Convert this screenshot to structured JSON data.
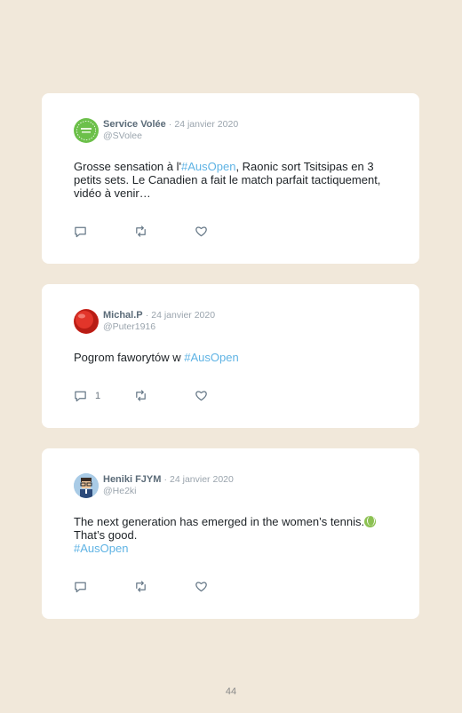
{
  "tweets": [
    {
      "name": "Service Volée",
      "separator": "·",
      "date": "24 janvier 2020",
      "handle": "@SVolee",
      "text_before": "Grosse sensation à l'",
      "hashtag": "#AusOpen",
      "text_after": ", Raonic sort Tsitsipas en 3 petits sets. Le Canadien a fait le match parfait tactiquement, vidéo à venir…",
      "reply_count": "",
      "avatar_color": "#6cc04a"
    },
    {
      "name": "Michal.P",
      "separator": "·",
      "date": "24 janvier 2020",
      "handle": "@Puter1916",
      "text_before": "Pogrom faworytów w ",
      "hashtag": "#AusOpen",
      "text_after": "",
      "reply_count": "1",
      "avatar_color": "#d42a20"
    },
    {
      "name": "Heniki FJYM",
      "separator": "·",
      "date": "24 janvier 2020",
      "handle": "@He2ki",
      "line1": "The next generation has emerged in the women’s tennis.",
      "line2": "That’s good.",
      "hashtag": "#AusOpen",
      "reply_count": "",
      "avatar_color": "#a9cbe6"
    }
  ],
  "page_number": "44",
  "colors": {
    "background": "#f1e8da",
    "card": "#ffffff",
    "hashtag": "#5fb3e4"
  },
  "icons": [
    "reply-icon",
    "retweet-icon",
    "like-icon",
    "tennis-ball-emoji"
  ]
}
